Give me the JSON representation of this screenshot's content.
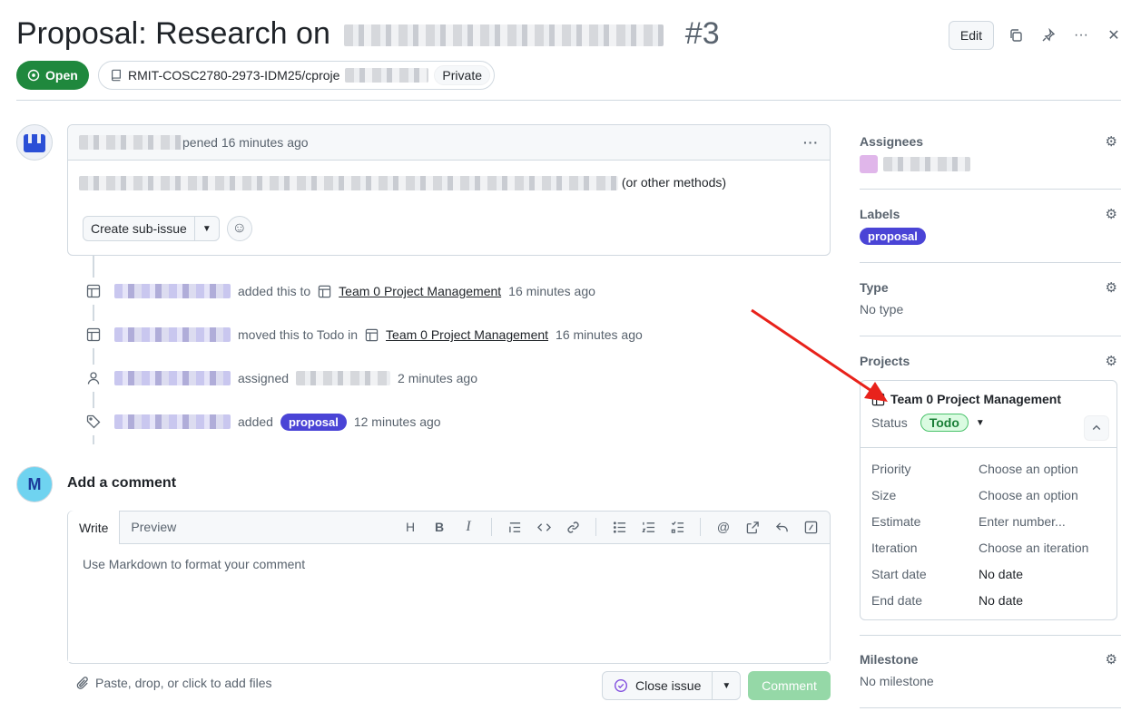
{
  "header": {
    "title_prefix": "Proposal: Research on",
    "issue_number": "#3",
    "edit_label": "Edit"
  },
  "state": {
    "label": "Open"
  },
  "repo": {
    "name": "RMIT-COSC2780-2973-IDM25/cproje",
    "visibility": "Private"
  },
  "opening_comment": {
    "action": "pened 16 minutes ago",
    "body_suffix": "(or other methods)",
    "create_sub_issue_label": "Create sub-issue"
  },
  "timeline": [
    {
      "icon": "table-icon",
      "action": "added this to",
      "project": "Team 0 Project Management",
      "time": "16 minutes ago"
    },
    {
      "icon": "table-icon",
      "action": "moved this to Todo in",
      "project": "Team 0 Project Management",
      "time": "16 minutes ago"
    },
    {
      "icon": "person-icon",
      "action": "assigned",
      "time": "2 minutes ago"
    },
    {
      "icon": "tag-icon",
      "action": "added",
      "label": "proposal",
      "time": "12 minutes ago"
    }
  ],
  "add_comment": {
    "title": "Add a comment",
    "tab_write": "Write",
    "tab_preview": "Preview",
    "placeholder": "Use Markdown to format your comment",
    "attach_text": "Paste, drop, or click to add files",
    "close_issue_label": "Close issue",
    "comment_label": "Comment"
  },
  "sidebar": {
    "assignees": {
      "title": "Assignees"
    },
    "labels": {
      "title": "Labels",
      "label": "proposal"
    },
    "type": {
      "title": "Type",
      "value": "No type"
    },
    "projects": {
      "title": "Projects",
      "name": "Team 0 Project Management",
      "status_key": "Status",
      "status_value": "Todo",
      "fields": [
        {
          "key": "Priority",
          "value": "Choose an option"
        },
        {
          "key": "Size",
          "value": "Choose an option"
        },
        {
          "key": "Estimate",
          "value": "Enter number..."
        },
        {
          "key": "Iteration",
          "value": "Choose an iteration"
        },
        {
          "key": "Start date",
          "value": "No date"
        },
        {
          "key": "End date",
          "value": "No date"
        }
      ]
    },
    "milestone": {
      "title": "Milestone",
      "value": "No milestone"
    }
  },
  "colors": {
    "open_green": "#1f883d",
    "label_purple": "#4a44d6",
    "annotation_red": "#e8221b"
  }
}
